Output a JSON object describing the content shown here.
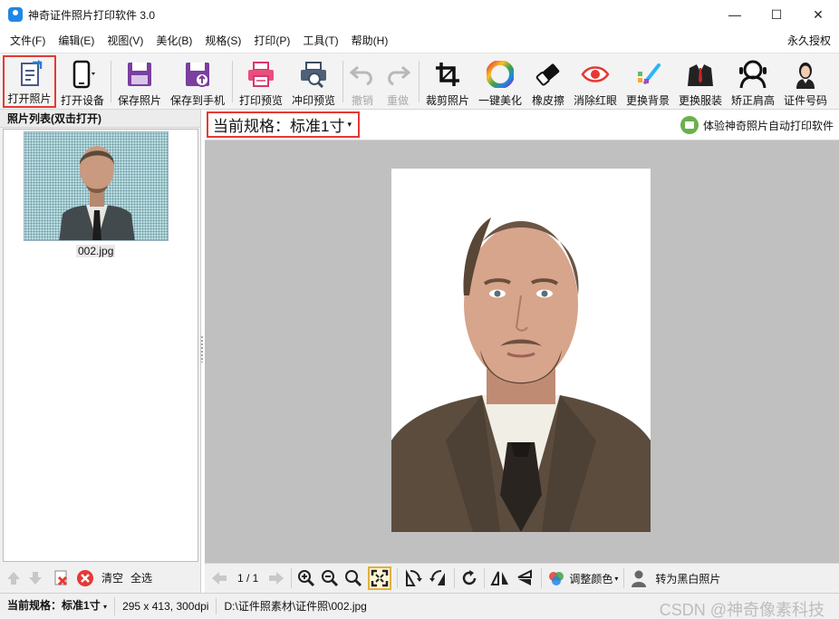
{
  "window": {
    "title": "神奇证件照片打印软件 3.0",
    "minimize": "—",
    "maximize": "☐",
    "close": "✕"
  },
  "menu": [
    "文件(F)",
    "编辑(E)",
    "视图(V)",
    "美化(B)",
    "规格(S)",
    "打印(P)",
    "工具(T)",
    "帮助(H)"
  ],
  "license": "永久授权",
  "toolbar": {
    "open_photo": "打开照片",
    "open_device": "打开设备",
    "save_photo": "保存照片",
    "save_to_phone": "保存到手机",
    "print_preview": "打印预览",
    "develop_preview": "冲印预览",
    "undo": "撤销",
    "redo": "重做",
    "crop": "裁剪照片",
    "beautify": "一键美化",
    "eraser": "橡皮擦",
    "red_eye": "消除红眼",
    "change_bg": "更换背景",
    "change_clothes": "更换服装",
    "correct_shoulder": "矫正肩高",
    "id_number": "证件号码"
  },
  "photo_list": {
    "header": "照片列表(双击打开)",
    "items": [
      {
        "name": "002.jpg"
      }
    ],
    "clear": "清空",
    "select_all": "全选"
  },
  "spec": {
    "label": "当前规格：标准1寸",
    "arrow": "▾"
  },
  "promo": "体验神奇照片自动打印软件",
  "viewer": {
    "page": "1 / 1",
    "adjust_color": "调整颜色",
    "to_bw": "转为黑白照片"
  },
  "status": {
    "spec_label": "当前规格：",
    "spec_value": "标准1寸",
    "size": "295 x 413, 300dpi",
    "path": "D:\\证件照素材\\证件照\\002.jpg"
  },
  "watermark": "CSDN @神奇像素科技",
  "colors": {
    "accent_red": "#e53935",
    "toolbar_bg": "#f3f3f3",
    "canvas_bg": "#c0c0c0",
    "brand_blue": "#1e88e5"
  }
}
